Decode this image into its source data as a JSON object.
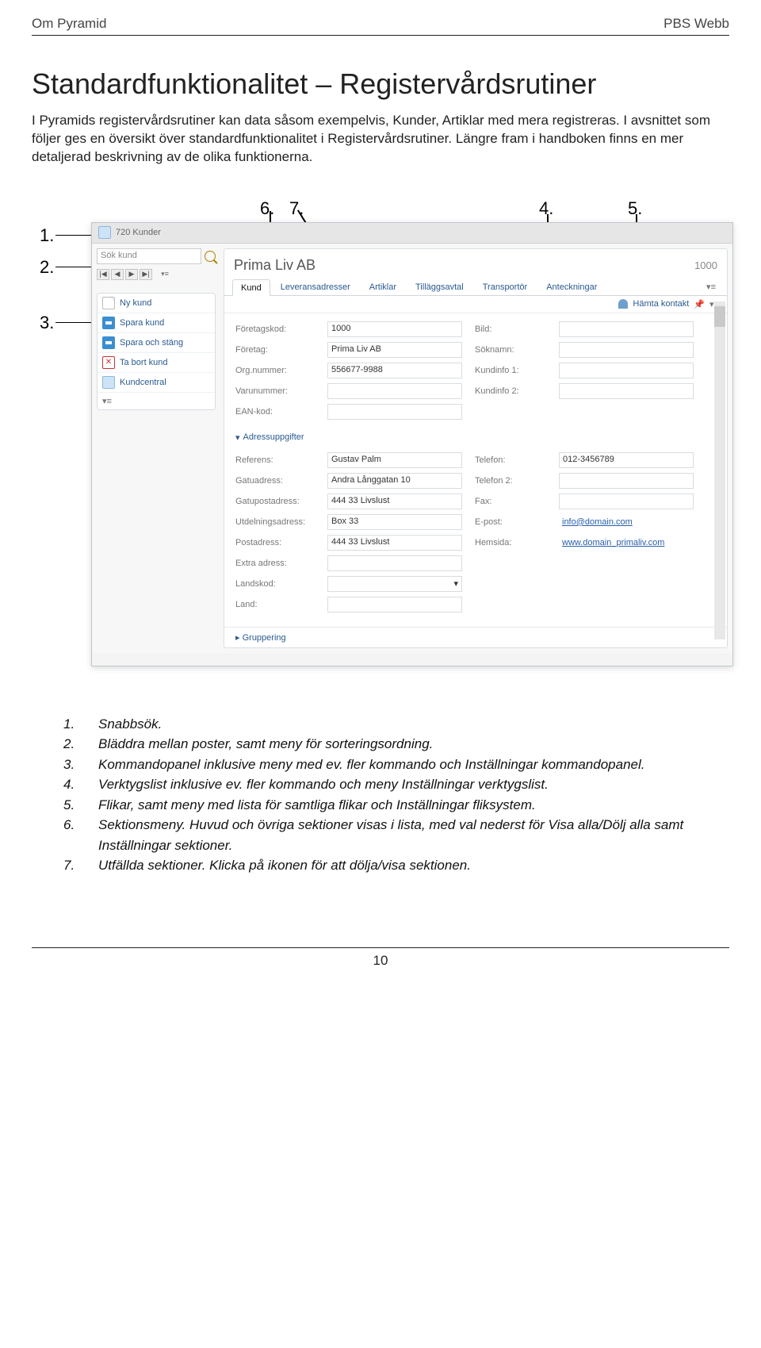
{
  "header": {
    "left": "Om Pyramid",
    "right": "PBS Webb"
  },
  "title": "Standardfunktionalitet – Registervårdsrutiner",
  "intro": "I Pyramids registervårdsrutiner kan data såsom exempelvis, Kunder, Artiklar med mera registreras. I avsnittet som följer ges en översikt över standardfunktionalitet i Registervårdsrutiner. Längre fram i handboken finns en mer detaljerad beskrivning av de olika funktionerna.",
  "callouts": {
    "1": "1.",
    "2": "2.",
    "3": "3.",
    "4": "4.",
    "5": "5.",
    "6": "6.",
    "7": "7."
  },
  "shot": {
    "titlebar": "720 Kunder",
    "search_placeholder": "Sök kund",
    "pager": [
      "|◀",
      "◀",
      "▶",
      "▶|"
    ],
    "pager_suffix": "▾≡",
    "commands": [
      {
        "icon": "new",
        "label": "Ny kund"
      },
      {
        "icon": "save",
        "label": "Spara kund"
      },
      {
        "icon": "save",
        "label": "Spara och stäng"
      },
      {
        "icon": "del",
        "label": "Ta bort kund"
      },
      {
        "icon": "kc",
        "label": "Kundcentral"
      }
    ],
    "cmd_suffix": "▾≡",
    "company": "Prima Liv AB",
    "company_code": "1000",
    "tabs": [
      "Kund",
      "Leveransadresser",
      "Artiklar",
      "Tilläggsavtal",
      "Transportör",
      "Anteckningar"
    ],
    "hamta": "Hämta kontakt",
    "row1": [
      {
        "l": "Företagskod:",
        "v": "1000"
      },
      {
        "l": "Bild:",
        "v": ""
      }
    ],
    "row2": [
      {
        "l": "Företag:",
        "v": "Prima Liv AB"
      },
      {
        "l": "Söknamn:",
        "v": ""
      }
    ],
    "row3": [
      {
        "l": "Org.nummer:",
        "v": "556677-9988"
      },
      {
        "l": "Kundinfo 1:",
        "v": ""
      }
    ],
    "row4": [
      {
        "l": "Varunummer:",
        "v": ""
      },
      {
        "l": "Kundinfo 2:",
        "v": ""
      }
    ],
    "row5": [
      {
        "l": "EAN-kod:",
        "v": ""
      }
    ],
    "section_address": "Adressuppgifter",
    "addr": [
      {
        "l": "Referens:",
        "v": "Gustav Palm",
        "l2": "Telefon:",
        "v2": "012-3456789"
      },
      {
        "l": "Gatuadress:",
        "v": "Andra Långgatan 10",
        "l2": "Telefon 2:",
        "v2": ""
      },
      {
        "l": "Gatupostadress:",
        "v": "444 33 Livslust",
        "l2": "Fax:",
        "v2": ""
      },
      {
        "l": "Utdelningsadress:",
        "v": "Box 33",
        "l2": "E-post:",
        "v2": "info@domain.com"
      },
      {
        "l": "Postadress:",
        "v": "444 33 Livslust",
        "l2": "Hemsida:",
        "v2": "www.domain_primaliv.com"
      },
      {
        "l": "Extra adress:",
        "v": ""
      },
      {
        "l": "Landskod:",
        "v": ""
      },
      {
        "l": "Land:",
        "v": ""
      }
    ],
    "gruppering": "Gruppering"
  },
  "legend": [
    {
      "n": "1.",
      "t": "Snabbsök."
    },
    {
      "n": "2.",
      "t": "Bläddra mellan poster, samt meny för sorteringsordning."
    },
    {
      "n": "3.",
      "t": "Kommandopanel inklusive meny med ev. fler kommando och Inställningar kommandopanel."
    },
    {
      "n": "4.",
      "t": "Verktygslist inklusive ev. fler kommando och meny Inställningar verktygslist."
    },
    {
      "n": "5.",
      "t": "Flikar, samt meny med lista för samtliga flikar och Inställningar fliksystem."
    },
    {
      "n": "6.",
      "t": "Sektionsmeny. Huvud och övriga sektioner visas i lista, med val nederst för Visa alla/Dölj alla samt Inställningar sektioner."
    },
    {
      "n": "7.",
      "t": "Utfällda sektioner. Klicka på ikonen för att dölja/visa sektionen."
    }
  ],
  "page_number": "10"
}
